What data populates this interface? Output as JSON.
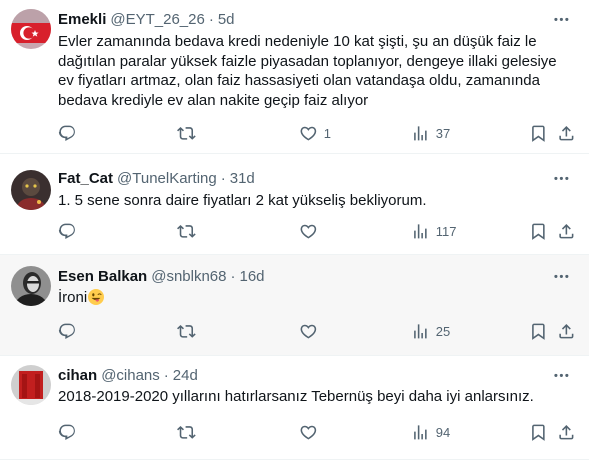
{
  "tweets": [
    {
      "name": "Emekli",
      "handle": "@EYT_26_26",
      "time": "5d",
      "lines": [
        "Evler zamanında  bedava kredi nedeniyle 10 kat şişti, şu an düşük  faiz le",
        "dağıtılan paralar yüksek faizle piyasadan  toplanıyor, dengeye illaki gelesiye",
        "ev fiyatları artmaz, olan faiz hassasiyeti olan vatandaşa oldu, zamanında",
        "bedava krediyle ev alan nakite geçip faiz alıyor"
      ],
      "likes": "1",
      "views": "37"
    },
    {
      "name": "Fat_Cat",
      "handle": "@TunelKarting",
      "time": "31d",
      "lines": [
        "1. 5 sene sonra daire fiyatları 2 kat yükseliş bekliyorum."
      ],
      "likes": "",
      "views": "117"
    },
    {
      "name": "Esen Balkan",
      "handle": "@snblkn68",
      "time": "16d",
      "lines": [
        "İroni"
      ],
      "emoji": "winking-face-tongue",
      "likes": "",
      "views": "25"
    },
    {
      "name": "cihan",
      "handle": "@cihans",
      "time": "24d",
      "lines": [
        "2018-2019-2020 yıllarını hatırlarsanız Tebernüş beyi daha iyi anlarsınız."
      ],
      "likes": "",
      "views": "94"
    }
  ],
  "separator": "·",
  "icons": [
    "reply-icon",
    "retweet-icon",
    "like-icon",
    "views-icon",
    "bookmark-icon",
    "share-icon",
    "more-icon"
  ]
}
